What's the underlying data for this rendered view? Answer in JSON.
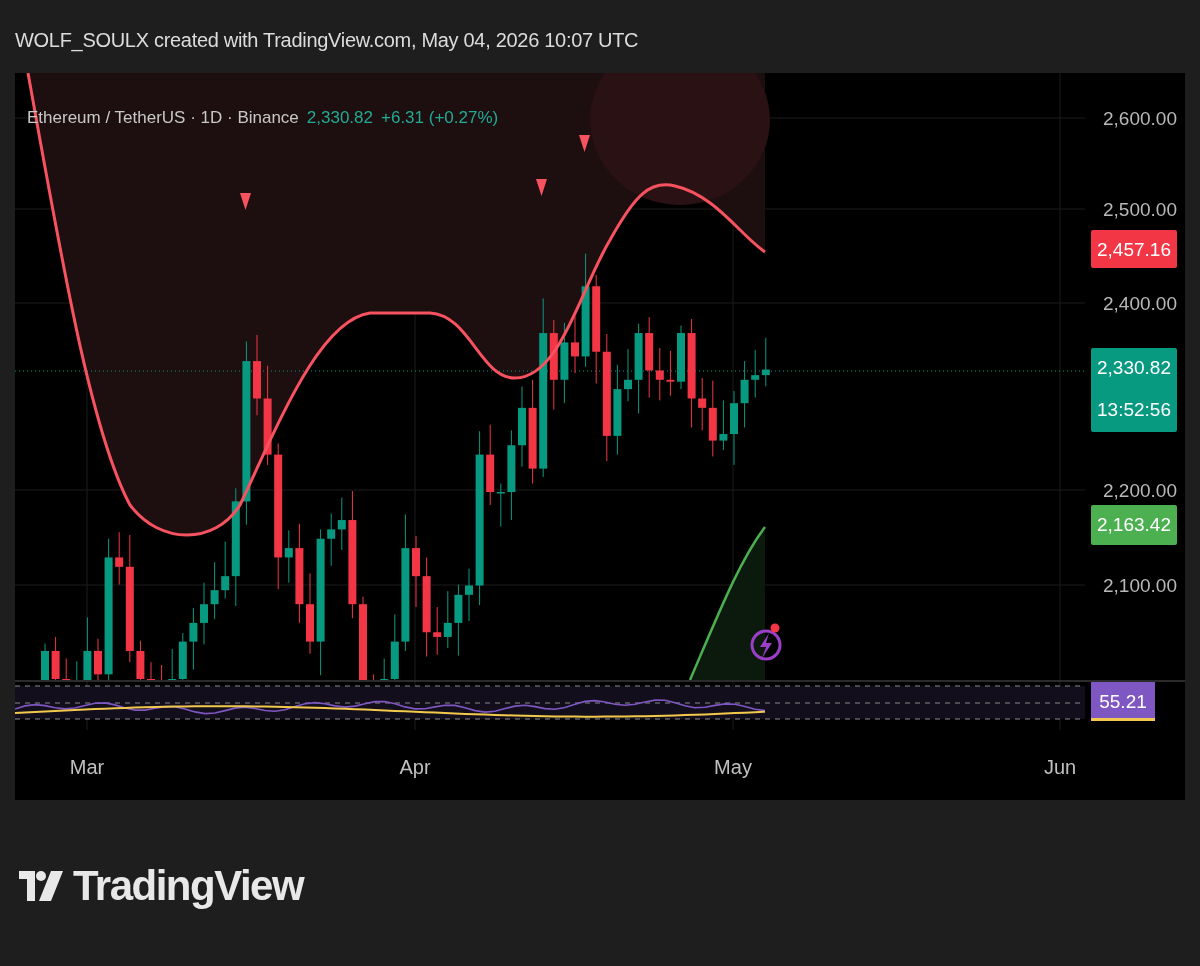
{
  "header": {
    "attribution": "WOLF_SOULX created with TradingView.com, May 04, 2026 10:07 UTC"
  },
  "legend": {
    "symbol": "Ethereum / TetherUS · 1D · Binance",
    "price": "2,330.82",
    "change": "+6.31 (+0.27%)"
  },
  "price_axis": {
    "ticks": [
      "2,600.00",
      "2,500.00",
      "2,400.00",
      "2,200.00",
      "2,100.00"
    ]
  },
  "price_tags": [
    {
      "text": "2,457.16",
      "color": "#f23645"
    },
    {
      "text": "2,330.82",
      "countdown": "13:52:56",
      "color": "#089981"
    },
    {
      "text": "2,163.42",
      "color": "#4caf50"
    }
  ],
  "rsi_tag": {
    "text": "55.21",
    "color": "#7e57c2"
  },
  "time_axis": {
    "labels": [
      "Mar",
      "Apr",
      "May",
      "Jun"
    ]
  },
  "brand": {
    "name": "TradingView"
  }
}
